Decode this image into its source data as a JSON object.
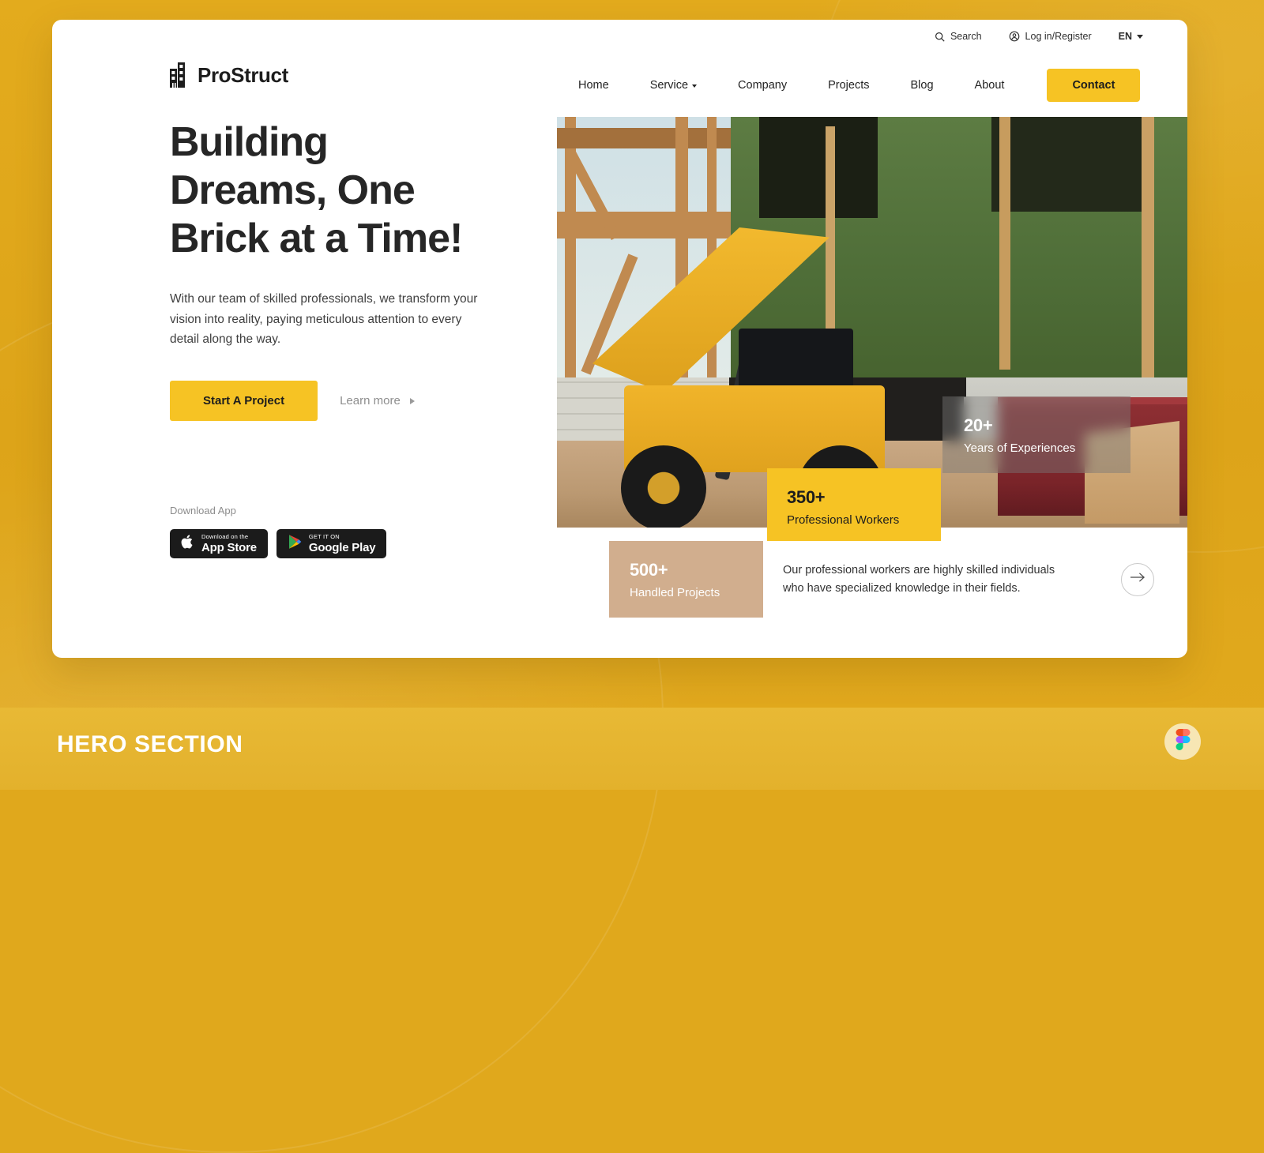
{
  "brand": {
    "name": "ProStruct",
    "logo_icon": "building-logo-icon",
    "accent": "#f6c324",
    "page_bg": "#e0a81c"
  },
  "utility": {
    "search": {
      "label": "Search",
      "icon": "search-icon"
    },
    "account": {
      "label": "Log in/Register",
      "icon": "user-circle-icon"
    },
    "language": {
      "label": "EN",
      "icon": "chevron-down-icon"
    }
  },
  "nav": {
    "items": [
      {
        "label": "Home",
        "has_dropdown": false
      },
      {
        "label": "Service",
        "has_dropdown": true
      },
      {
        "label": "Company",
        "has_dropdown": false
      },
      {
        "label": "Projects",
        "has_dropdown": false
      },
      {
        "label": "Blog",
        "has_dropdown": false
      },
      {
        "label": "About",
        "has_dropdown": false
      }
    ],
    "contact_label": "Contact"
  },
  "hero": {
    "headline_line1": "Building",
    "headline_line2": "Dreams, One",
    "headline_line3": "Brick at a Time!",
    "subtext": "With our team of skilled professionals, we transform your vision into reality, paying meticulous attention to every detail along the way.",
    "primary_cta": "Start A Project",
    "secondary_cta": "Learn more",
    "secondary_cta_icon": "triangle-right-icon",
    "image_alt": "yellow telehandler at a construction site with wood framing and green sheathing"
  },
  "download": {
    "label": "Download App",
    "app_store": {
      "top": "Download on the",
      "bottom": "App Store",
      "icon": "apple-icon"
    },
    "google_play": {
      "top": "GET IT ON",
      "bottom": "Google Play",
      "icon": "google-play-icon"
    }
  },
  "stats": {
    "experience": {
      "number": "20+",
      "label": "Years of Experiences"
    },
    "workers": {
      "number": "350+",
      "label": "Professional Workers"
    },
    "projects": {
      "number": "500+",
      "label": "Handled Projects"
    }
  },
  "description": {
    "text": "Our professional workers are highly skilled individuals who have specialized knowledge in their fields.",
    "arrow_icon": "arrow-right-icon"
  },
  "banner": {
    "title": "HERO SECTION",
    "badge_icon": "figma-icon"
  }
}
